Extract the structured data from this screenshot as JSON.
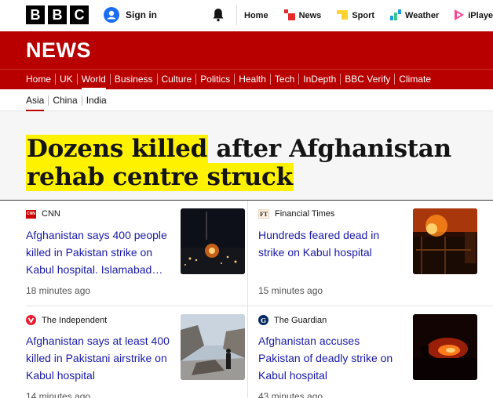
{
  "topbar": {
    "logo_letters": [
      "B",
      "B",
      "C"
    ],
    "signin_label": "Sign in",
    "nav": [
      {
        "label": "Home",
        "icon": ""
      },
      {
        "label": "News",
        "icon": "news-icon",
        "color": "#e32b2b"
      },
      {
        "label": "Sport",
        "icon": "sport-icon",
        "color": "#ffd230"
      },
      {
        "label": "Weather",
        "icon": "weather-icon",
        "color": "#1a9fe0"
      },
      {
        "label": "iPlayer",
        "icon": "iplayer-icon",
        "color": "#f54997"
      }
    ]
  },
  "banner": {
    "title": "NEWS",
    "color": "#b80000"
  },
  "sections": [
    "Home",
    "UK",
    "World",
    "Business",
    "Culture",
    "Politics",
    "Health",
    "Tech",
    "InDepth",
    "BBC Verify",
    "Climate"
  ],
  "active_section": "World",
  "subsections": [
    "Asia",
    "China",
    "India"
  ],
  "active_subsection": "Asia",
  "headline": {
    "highlighted_1": "Dozens killed",
    "plain_1": " after Afghanistan",
    "highlighted_2": "rehab centre struck"
  },
  "cards": [
    {
      "source": "CNN",
      "logo": "cnn-logo",
      "title": "Afghanistan says 400 people killed in Pakistan strike on Kabul hospital. Islamabad…",
      "time": "18 minutes ago",
      "image": "night-explosion-image"
    },
    {
      "source": "Financial Times",
      "logo": "ft-logo",
      "title": "Hundreds feared dead in strike on Kabul hospital",
      "time": "15 minutes ago",
      "image": "fire-building-image"
    },
    {
      "source": "The Independent",
      "logo": "independent-logo",
      "title": "Afghanistan says at least 400 killed in Pakistani airstrike on Kabul hospital",
      "time": "14 minutes ago",
      "image": "ruins-street-image"
    },
    {
      "source": "The Guardian",
      "logo": "guardian-logo",
      "title": "Afghanistan accuses Pakistan of deadly strike on Kabul hospital",
      "time": "43 minutes ago",
      "image": "night-fire-image"
    }
  ],
  "highlight_color": "#fff200"
}
